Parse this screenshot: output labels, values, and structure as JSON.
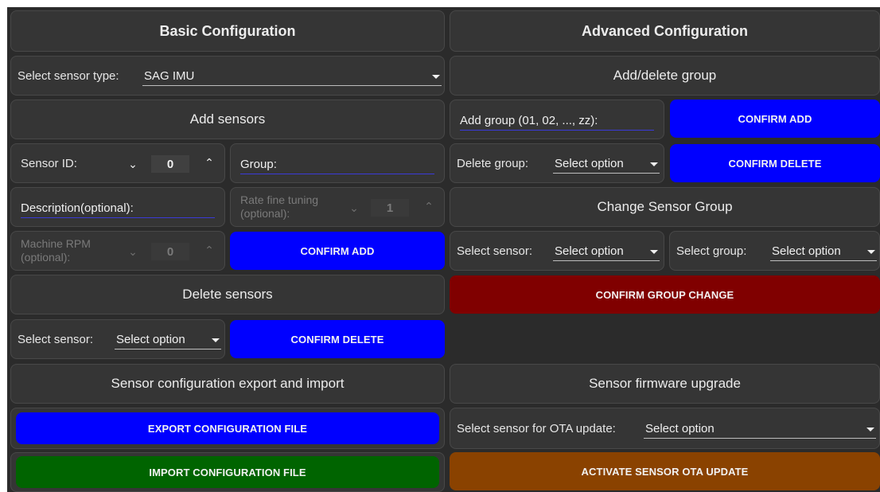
{
  "basic": {
    "title": "Basic Configuration",
    "sensor_type_label": "Select sensor type:",
    "sensor_type_value": "SAG IMU",
    "add_sensors_title": "Add sensors",
    "sensor_id_label": "Sensor ID:",
    "sensor_id_value": "0",
    "group_placeholder": "Group:",
    "description_placeholder": "Description(optional):",
    "rate_label": "Rate fine tuning (optional):",
    "rate_value": "1",
    "rpm_label": "Machine RPM (optional):",
    "rpm_value": "0",
    "confirm_add": "CONFIRM ADD",
    "delete_sensors_title": "Delete sensors",
    "delete_sensor_label": "Select sensor:",
    "delete_sensor_value": "Select option",
    "confirm_delete": "CONFIRM DELETE",
    "export_import_title": "Sensor configuration export and import",
    "export_button": "EXPORT CONFIGURATION FILE",
    "import_button": "IMPORT CONFIGURATION FILE"
  },
  "advanced": {
    "title": "Advanced Configuration",
    "add_delete_group_title": "Add/delete group",
    "add_group_placeholder": "Add group (01, 02, ..., zz):",
    "confirm_add": "CONFIRM ADD",
    "delete_group_label": "Delete group:",
    "delete_group_value": "Select option",
    "confirm_delete": "CONFIRM DELETE",
    "change_group_title": "Change Sensor Group",
    "change_sensor_label": "Select sensor:",
    "change_sensor_value": "Select option",
    "change_group_label": "Select group:",
    "change_group_value": "Select option",
    "confirm_group_change": "CONFIRM GROUP CHANGE",
    "firmware_title": "Sensor firmware upgrade",
    "ota_label": "Select sensor for OTA update:",
    "ota_value": "Select option",
    "activate_ota": "ACTIVATE SENSOR OTA UPDATE"
  },
  "colors": {
    "blue_button": "#0000ff",
    "green_button": "#006400",
    "red_button": "#800000",
    "orange_button": "#8a4200",
    "panel": "#353535",
    "background": "#2b2b2b"
  }
}
